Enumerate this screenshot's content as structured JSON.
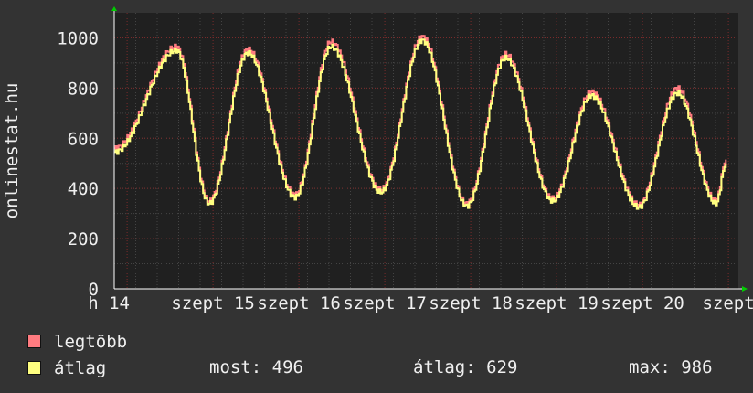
{
  "chart_data": {
    "type": "line",
    "ylabel": "onlinestat.hu",
    "ylim": [
      0,
      1100
    ],
    "yticks": [
      0,
      200,
      400,
      600,
      800,
      1000
    ],
    "x_tick_labels": [
      "h 14",
      "szept 15",
      "szept 16",
      "szept 17",
      "szept 18",
      "szept 19",
      "szept 20",
      "szept"
    ],
    "grid": true,
    "colors": {
      "bg": "#333333",
      "plot": "#202020",
      "grid_minor": "#444444",
      "grid_major": "#7a2b2b",
      "axis": "#ffffff",
      "arrow": "#00cc00"
    },
    "series": [
      {
        "name": "legtöbb",
        "color": "#ff7b80",
        "peaks": [
          {
            "day": 0.72,
            "v": 965
          },
          {
            "day": 1.55,
            "v": 955
          },
          {
            "day": 2.52,
            "v": 985
          },
          {
            "day": 3.58,
            "v": 1005
          },
          {
            "day": 4.55,
            "v": 935
          },
          {
            "day": 5.55,
            "v": 785
          },
          {
            "day": 6.55,
            "v": 800
          }
        ],
        "troughs": [
          {
            "day": 0,
            "v": 560
          },
          {
            "day": 1.1,
            "v": 350
          },
          {
            "day": 2.1,
            "v": 375
          },
          {
            "day": 3.1,
            "v": 395
          },
          {
            "day": 4.1,
            "v": 340
          },
          {
            "day": 5.1,
            "v": 360
          },
          {
            "day": 6.1,
            "v": 335
          },
          {
            "day": 7.0,
            "v": 350
          },
          {
            "day": 7.12,
            "v": 515
          }
        ]
      },
      {
        "name": "átlag",
        "color": "#ffff80",
        "peaks": [
          {
            "day": 0.72,
            "v": 950
          },
          {
            "day": 1.55,
            "v": 940
          },
          {
            "day": 2.52,
            "v": 965
          },
          {
            "day": 3.58,
            "v": 990
          },
          {
            "day": 4.55,
            "v": 920
          },
          {
            "day": 5.55,
            "v": 770
          },
          {
            "day": 6.55,
            "v": 780
          }
        ],
        "troughs": [
          {
            "day": 0,
            "v": 545
          },
          {
            "day": 1.1,
            "v": 340
          },
          {
            "day": 2.1,
            "v": 365
          },
          {
            "day": 3.1,
            "v": 385
          },
          {
            "day": 4.1,
            "v": 330
          },
          {
            "day": 5.1,
            "v": 350
          },
          {
            "day": 6.1,
            "v": 325
          },
          {
            "day": 7.0,
            "v": 340
          },
          {
            "day": 7.12,
            "v": 500
          }
        ]
      }
    ]
  },
  "legend": {
    "items": [
      {
        "label": "legtöbb",
        "color": "#ff7b80"
      },
      {
        "label": "átlag",
        "color": "#ffff80"
      }
    ],
    "stats": {
      "most": "most: 496",
      "atlag": "átlag: 629",
      "max": "max: 986"
    }
  }
}
